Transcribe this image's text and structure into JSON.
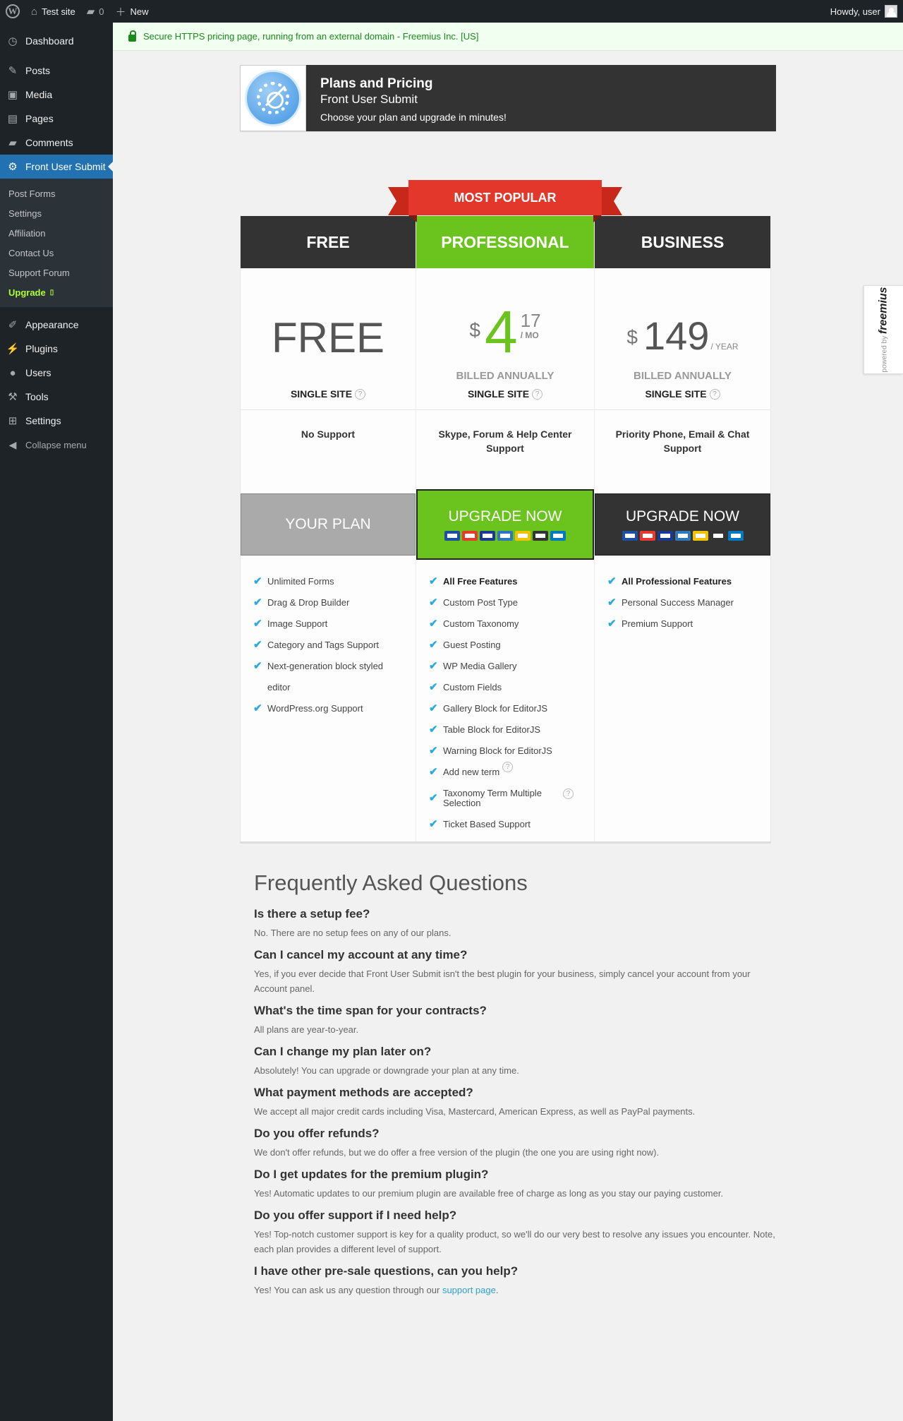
{
  "adminbar": {
    "site_name": "Test site",
    "comments_count": "0",
    "new_label": "New",
    "howdy": "Howdy, user"
  },
  "sidebar": {
    "items_top": [
      {
        "label": "Dashboard",
        "icon": "dashboard-icon"
      }
    ],
    "items_mid": [
      {
        "label": "Posts",
        "icon": "pin-icon"
      },
      {
        "label": "Media",
        "icon": "media-icon"
      },
      {
        "label": "Pages",
        "icon": "pages-icon"
      },
      {
        "label": "Comments",
        "icon": "comments-icon"
      }
    ],
    "current": {
      "label": "Front User Submit",
      "icon": "gear-icon"
    },
    "submenu": [
      "Post Forms",
      "Settings",
      "Affiliation",
      "Contact Us",
      "Support Forum",
      "Upgrade"
    ],
    "items_bottom": [
      {
        "label": "Appearance",
        "icon": "brush-icon"
      },
      {
        "label": "Plugins",
        "icon": "plug-icon"
      },
      {
        "label": "Users",
        "icon": "user-icon"
      },
      {
        "label": "Tools",
        "icon": "wrench-icon"
      },
      {
        "label": "Settings",
        "icon": "settings-icon"
      }
    ],
    "collapse": "Collapse menu"
  },
  "notice": "Secure HTTPS pricing page, running from an external domain - Freemius Inc. [US]",
  "header": {
    "title": "Plans and Pricing",
    "plugin": "Front User Submit",
    "tagline": "Choose your plan and upgrade in minutes!"
  },
  "ribbon": "MOST POPULAR",
  "plans": {
    "free": {
      "name": "FREE",
      "price": "FREE",
      "sites": "SINGLE SITE",
      "support": "No Support",
      "cta": "YOUR PLAN",
      "features": [
        "Unlimited Forms",
        "Drag & Drop Builder",
        "Image Support",
        "Category and Tags Support",
        "Next-generation block styled",
        "editor",
        "WordPress.org Support"
      ]
    },
    "pro": {
      "name": "PROFESSIONAL",
      "currency": "$",
      "price": "4",
      "cents": "17",
      "period": "/ MO",
      "billed": "BILLED ANNUALLY",
      "sites": "SINGLE SITE",
      "support": "Skype, Forum & Help Center Support",
      "cta": "UPGRADE NOW",
      "features": [
        "All Free Features",
        "Custom Post Type",
        "Custom Taxonomy",
        "Guest Posting",
        "WP Media Gallery",
        "Custom Fields",
        "Gallery Block for EditorJS",
        "Table Block for EditorJS",
        "Warning Block for EditorJS",
        "Add new term",
        "Taxonomy Term Multiple Selection",
        "Ticket Based Support"
      ]
    },
    "biz": {
      "name": "BUSINESS",
      "currency": "$",
      "price": "149",
      "period": "/ YEAR",
      "billed": "BILLED ANNUALLY",
      "sites": "SINGLE SITE",
      "support": "Priority Phone, Email & Chat Support",
      "cta": "UPGRADE NOW",
      "features": [
        "All Professional Features",
        "Personal Success Manager",
        "Premium Support"
      ]
    }
  },
  "card_colors": [
    "#1d4fa1",
    "#e8392e",
    "#1a3a8f",
    "#2e77bc",
    "#f2c200",
    "#333333",
    "#0079c1"
  ],
  "freemius": {
    "powered": "powered by",
    "brand": "freemius"
  },
  "faq": {
    "title": "Frequently Asked Questions",
    "items": [
      {
        "q": "Is there a setup fee?",
        "a": "No. There are no setup fees on any of our plans."
      },
      {
        "q": "Can I cancel my account at any time?",
        "a": "Yes, if you ever decide that Front User Submit isn't the best plugin for your business, simply cancel your account from your Account panel."
      },
      {
        "q": "What's the time span for your contracts?",
        "a": "All plans are year-to-year."
      },
      {
        "q": "Can I change my plan later on?",
        "a": "Absolutely! You can upgrade or downgrade your plan at any time."
      },
      {
        "q": "What payment methods are accepted?",
        "a": "We accept all major credit cards including Visa, Mastercard, American Express, as well as PayPal payments."
      },
      {
        "q": "Do you offer refunds?",
        "a": "We don't offer refunds, but we do offer a free version of the plugin (the one you are using right now)."
      },
      {
        "q": "Do I get updates for the premium plugin?",
        "a": "Yes! Automatic updates to our premium plugin are available free of charge as long as you stay our paying customer."
      },
      {
        "q": "Do you offer support if I need help?",
        "a": "Yes! Top-notch customer support is key for a quality product, so we'll do our very best to resolve any issues you encounter. Note, each plan provides a different level of support."
      },
      {
        "q": "I have other pre-sale questions, can you help?",
        "a": "Yes! You can ask us any question through our",
        "link": "support page",
        "after": "."
      }
    ]
  }
}
